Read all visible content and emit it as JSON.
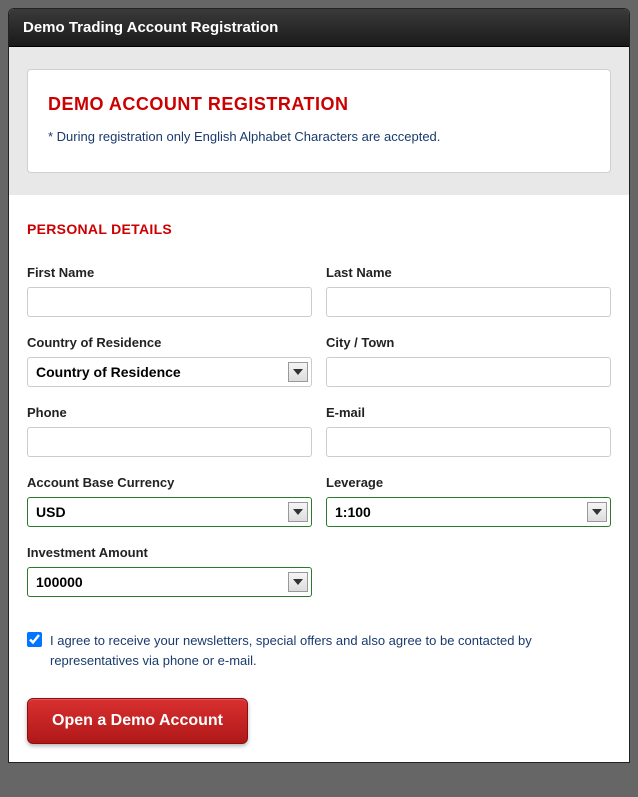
{
  "window": {
    "title": "Demo Trading Account Registration"
  },
  "info": {
    "title": "DEMO ACCOUNT REGISTRATION",
    "note": "* During registration only English Alphabet Characters are accepted."
  },
  "section": {
    "personal_details": "PERSONAL DETAILS"
  },
  "fields": {
    "first_name": {
      "label": "First Name",
      "value": ""
    },
    "last_name": {
      "label": "Last Name",
      "value": ""
    },
    "country": {
      "label": "Country of Residence",
      "value": "Country of Residence"
    },
    "city": {
      "label": "City / Town",
      "value": ""
    },
    "phone": {
      "label": "Phone",
      "value": ""
    },
    "email": {
      "label": "E-mail",
      "value": ""
    },
    "currency": {
      "label": "Account Base Currency",
      "value": "USD"
    },
    "leverage": {
      "label": "Leverage",
      "value": "1:100"
    },
    "investment": {
      "label": "Investment Amount",
      "value": "100000"
    }
  },
  "consent": {
    "checked": true,
    "text": "I agree to receive your newsletters, special offers and also agree to be contacted by representatives via phone or e-mail."
  },
  "submit": {
    "label": "Open a Demo Account"
  }
}
